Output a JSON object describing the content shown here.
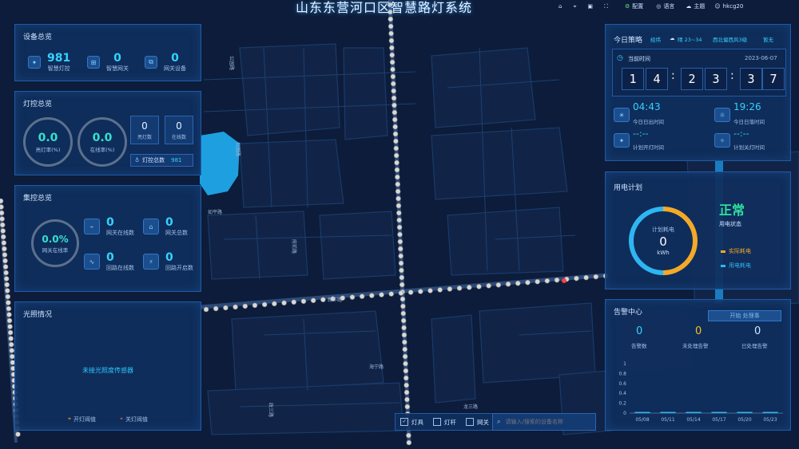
{
  "header": {
    "title": "山东东营河口区智慧路灯系统",
    "menu": [
      "配置",
      "语言",
      "主题",
      "hkcg20"
    ]
  },
  "device_overview": {
    "title": "设备总览",
    "items": [
      {
        "value": "981",
        "label": "智慧灯控"
      },
      {
        "value": "0",
        "label": "智慧网关"
      },
      {
        "value": "0",
        "label": "网关设备"
      }
    ]
  },
  "light_overview": {
    "title": "灯控总览",
    "rings": [
      {
        "value": "0.0",
        "label": "亮灯率(%)"
      },
      {
        "value": "0.0",
        "label": "在线率(%)"
      }
    ],
    "counters": [
      {
        "value": "0",
        "label": "亮灯数"
      },
      {
        "value": "0",
        "label": "在线数"
      }
    ],
    "total_label": "灯控总数",
    "total_value": "981"
  },
  "concentrator": {
    "title": "集控总览",
    "ring_value": "0.0%",
    "ring_label": "网关在线率",
    "items": [
      {
        "value": "0",
        "label": "网关在线数"
      },
      {
        "value": "0",
        "label": "网关总数"
      },
      {
        "value": "0",
        "label": "回路在线数"
      },
      {
        "value": "0",
        "label": "回路开启数"
      }
    ]
  },
  "illumination": {
    "title": "光照情况",
    "empty_text": "未接光照度传感器",
    "legend_on": "开灯阈值",
    "legend_off": "关灯阈值"
  },
  "today": {
    "title": "今日策略",
    "tabs": [
      "经纬",
      "晴 23~34",
      "西北偏西风3级",
      "暂无"
    ],
    "clock_label": "当前时间",
    "date": "2023-06-07",
    "time_digits": [
      "1",
      "4",
      "2",
      "3",
      "3",
      "7"
    ],
    "sunrise": {
      "value": "04:43",
      "label": "今日日出时间"
    },
    "sunset": {
      "value": "19:26",
      "label": "今日日落时间"
    },
    "plan_on": {
      "value": "--:--",
      "label": "计划开灯时间"
    },
    "plan_off": {
      "value": "--:--",
      "label": "计划关灯时间"
    }
  },
  "power": {
    "title": "用电计划",
    "gauge_label": "计划耗电",
    "gauge_value": "0",
    "gauge_unit": "kWh",
    "status_value": "正常",
    "status_label": "用电状态",
    "legend": [
      {
        "name": "实际耗电",
        "color": "#f4a928"
      },
      {
        "name": "用电耗电",
        "color": "#2eb6f2"
      }
    ]
  },
  "alarm": {
    "title": "告警中心",
    "button": "开始 处理事",
    "stats": [
      {
        "value": "0",
        "label": "告警数",
        "color": "#34d1ff"
      },
      {
        "value": "0",
        "label": "未处理告警",
        "color": "#f4c128"
      },
      {
        "value": "0",
        "label": "已处理告警",
        "color": "#cfe3ff"
      }
    ]
  },
  "map": {
    "street_labels": [
      "公园路",
      "公园路",
      "如平路",
      "府前路",
      "新华路",
      "海宁路",
      "政三路",
      "龙三路"
    ],
    "legend": [
      "灯具",
      "灯杆",
      "网关"
    ],
    "search_placeholder": "请输入/搜索的设备名称"
  },
  "chart_data": {
    "type": "bar",
    "categories": [
      "05/08",
      "05/11",
      "05/14",
      "05/17",
      "05/20",
      "05/23"
    ],
    "values": [
      0,
      0,
      0,
      0,
      0,
      0
    ],
    "ylim": [
      0,
      1
    ],
    "yticks": [
      "1",
      "0.8",
      "0.6",
      "0.4",
      "0.2",
      "0"
    ],
    "grid": false
  }
}
